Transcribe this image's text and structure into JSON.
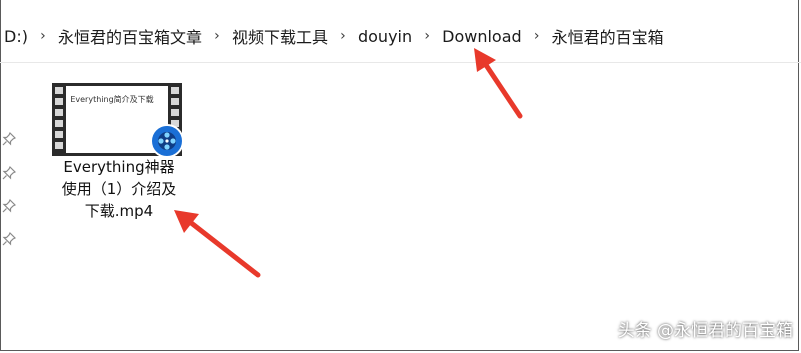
{
  "breadcrumb": {
    "drive": "D:)",
    "items": [
      "永恒君的百宝箱文章",
      "视频下载工具",
      "douyin",
      "Download",
      "永恒君的百宝箱"
    ],
    "separator_icon": "chevron-right-icon"
  },
  "quick_access_pins": [
    "pin-icon",
    "pin-icon",
    "pin-icon",
    "pin-icon"
  ],
  "file": {
    "name_line1": "Everything神器",
    "name_line2": "使用（1）介绍及",
    "name_line3": "下载.mp4",
    "thumbnail_text": "Everything简介及下载",
    "icon": "video-file-icon",
    "badge_icon": "media-player-icon"
  },
  "annotations": {
    "arrow_color": "#e8392b"
  },
  "watermark": "头条 @永恒君的百宝箱"
}
